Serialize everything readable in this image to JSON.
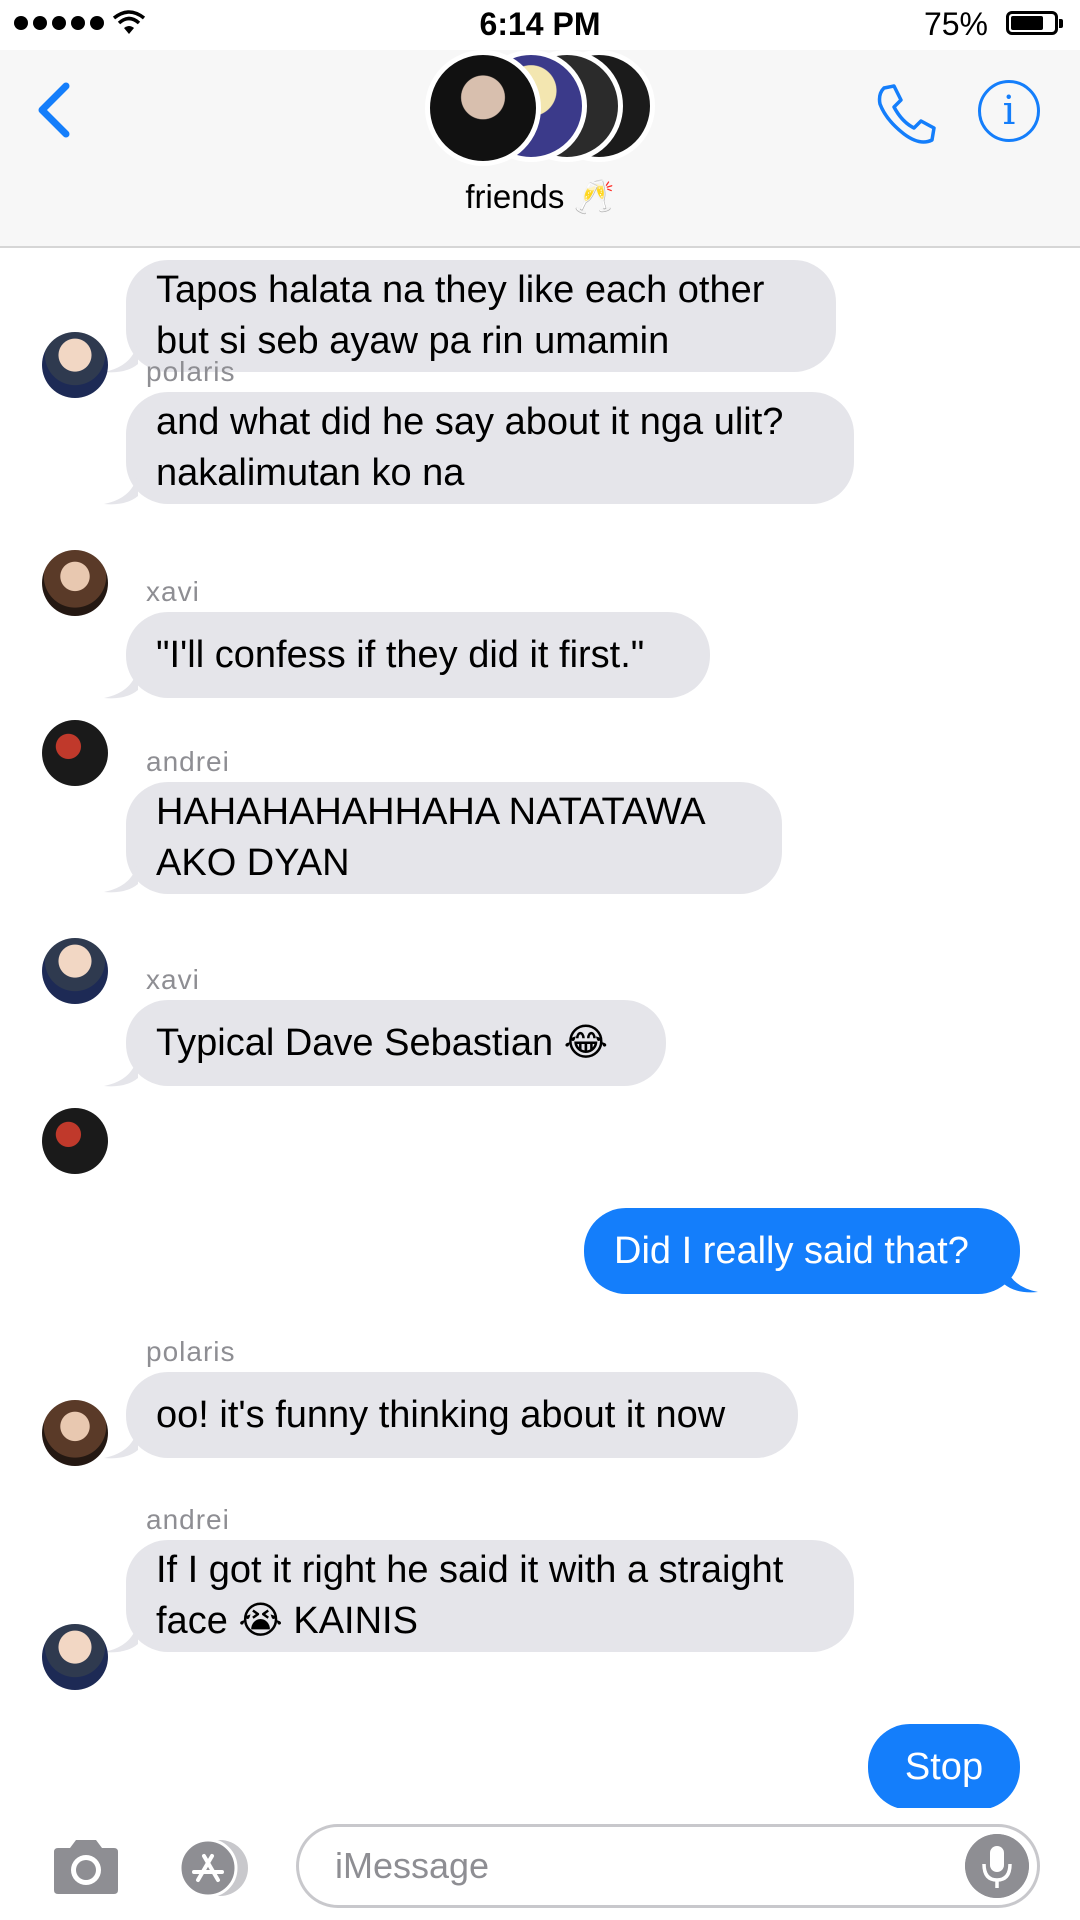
{
  "status_bar": {
    "time": "6:14 PM",
    "battery": "75%",
    "battery_level": 0.75
  },
  "header": {
    "group_name": "friends 🥂",
    "info_icon_label": "i"
  },
  "messages": [
    {
      "sender": "",
      "text": "Tapos halata na they like each other but si seb ayaw pa rin umamin",
      "direction": "in",
      "avatar": "andrei"
    },
    {
      "sender": "polaris",
      "text": "and what did he say about it nga ulit? nakalimutan ko na",
      "direction": "in",
      "avatar": "polaris"
    },
    {
      "sender": "xavi",
      "text": "\"I'll confess if they did it first.\"",
      "direction": "in",
      "avatar": "xavi"
    },
    {
      "sender": "andrei",
      "text": "HAHAHAHAHHAHA NATATAWA AKO DYAN",
      "direction": "in",
      "avatar": "andrei"
    },
    {
      "sender": "xavi",
      "text": "Typical Dave Sebastian 😂",
      "direction": "in",
      "avatar": "xavi"
    },
    {
      "sender": "",
      "text": "Did I really said that?",
      "direction": "out"
    },
    {
      "sender": "polaris",
      "text": "oo! it's funny thinking about it now",
      "direction": "in",
      "avatar": "polaris"
    },
    {
      "sender": "andrei",
      "text": "If I got it right he said it with a straight face 😭 KAINIS",
      "direction": "in",
      "avatar": "andrei"
    },
    {
      "sender": "",
      "text": "Stop",
      "direction": "out"
    }
  ],
  "input": {
    "placeholder": "iMessage"
  },
  "colors": {
    "accent": "#147efb",
    "incoming_bubble": "#e5e5ea",
    "outgoing_bubble": "#147efb"
  }
}
